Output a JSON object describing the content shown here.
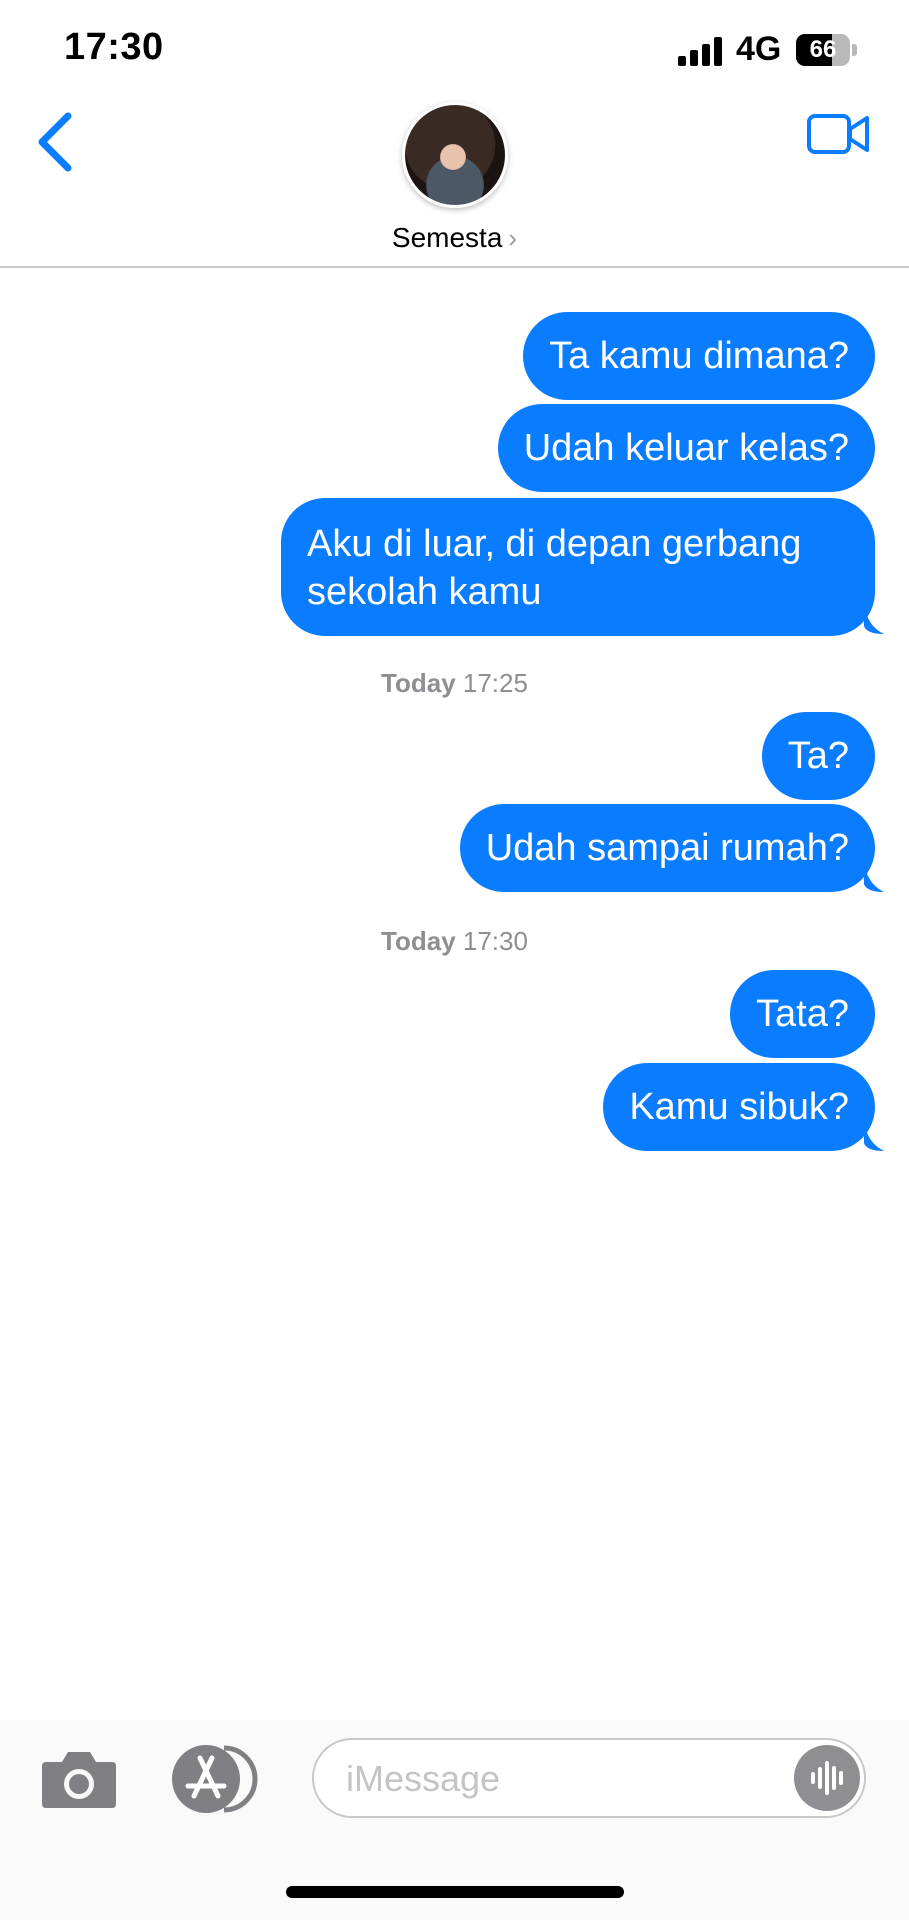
{
  "status_bar": {
    "time": "17:30",
    "network": "4G",
    "battery_percent": "66",
    "battery_level": 0.66,
    "icons": [
      "signal-bars-icon",
      "battery-icon"
    ]
  },
  "header": {
    "contact_name": "Semesta",
    "chevron": "›",
    "icons": [
      "back-chevron-icon",
      "avatar",
      "video-call-icon"
    ]
  },
  "messages": {
    "items": [
      {
        "text": "Ta kamu dimana?",
        "direction": "outgoing"
      },
      {
        "text": "Udah keluar kelas?",
        "direction": "outgoing"
      },
      {
        "text": "Aku di luar, di depan gerbang sekolah kamu",
        "direction": "outgoing"
      },
      {
        "text": "Ta?",
        "direction": "outgoing"
      },
      {
        "text": "Udah sampai rumah?",
        "direction": "outgoing"
      },
      {
        "text": "Tata?",
        "direction": "outgoing"
      },
      {
        "text": "Kamu sibuk?",
        "direction": "outgoing"
      }
    ],
    "timestamps": [
      {
        "day": "Today",
        "time": "17:25"
      },
      {
        "day": "Today",
        "time": "17:30"
      }
    ]
  },
  "compose": {
    "placeholder": "iMessage",
    "value": "",
    "icons": [
      "camera-icon",
      "app-store-icon",
      "audio-waveform-icon"
    ]
  },
  "colors": {
    "accent": "#0a7cff",
    "bubble_text": "#ffffff",
    "timestamp": "#8e8e93"
  }
}
